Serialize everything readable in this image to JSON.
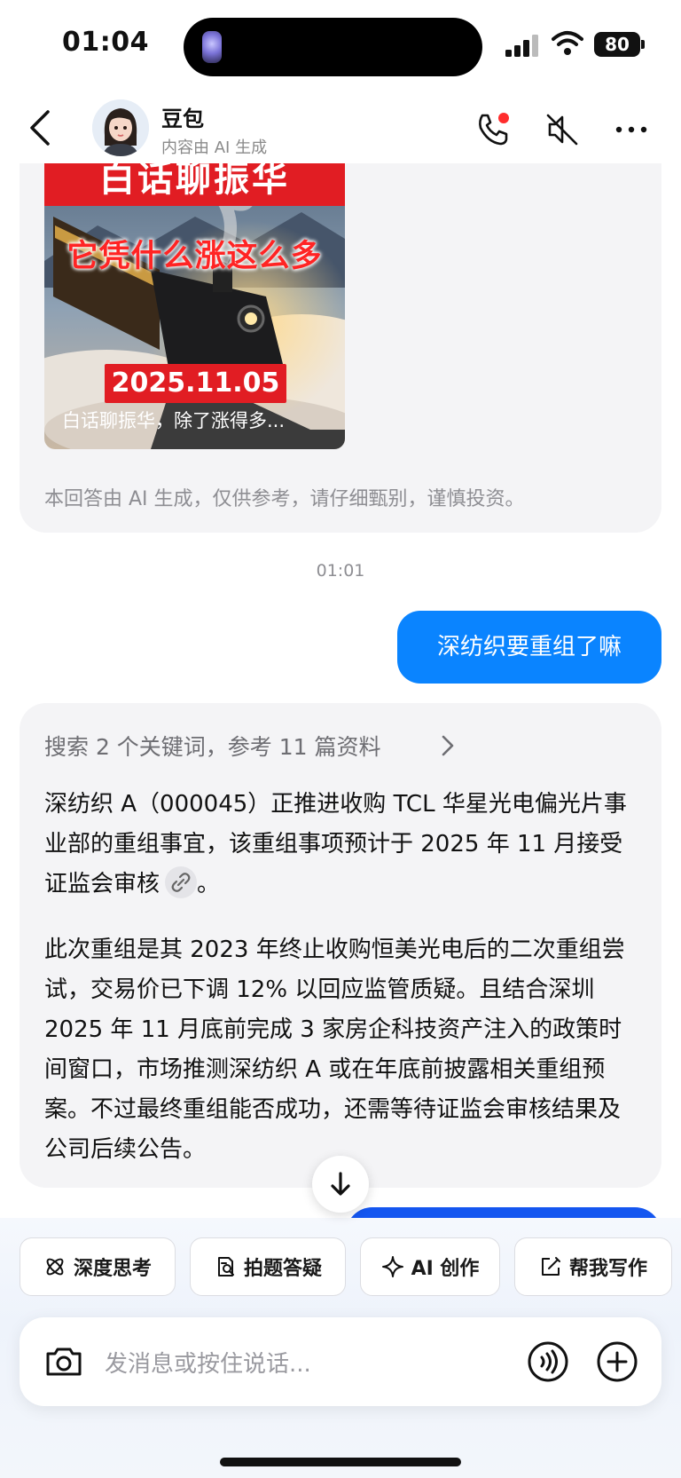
{
  "status_bar": {
    "time": "01:04",
    "battery": "80"
  },
  "header": {
    "name": "豆包",
    "subtitle": "内容由 AI 生成"
  },
  "news_card": {
    "thumb_title": "白话聊振华",
    "thumb_subtitle": "它凭什么涨这么多",
    "thumb_date": "2025.11.05",
    "thumb_caption": "白话聊振华，除了涨得多...",
    "disclaimer": "本回答由 AI 生成，仅供参考，请仔细甄别，谨慎投资。"
  },
  "timestamp": "01:01",
  "user_message": "深纺织要重组了嘛",
  "answer": {
    "search_summary": "搜索 2 个关键词，参考 11 篇资料",
    "para1": "深纺织 A（000045）正推进收购 TCL 华星光电偏光片事业部的重组事宜，该重组事项预计于 2025 年 11 月接受证监会审核",
    "para1_end": "。",
    "para2": "此次重组是其 2023 年终止收购恒美光电后的二次重组尝试，交易价已下调 12% 以回应监管质疑。且结合深圳 2025 年 11 月底前完成 3 家房企科技资产注入的政策时间窗口，市场推测深纺织 A 或在年底前披露相关重组预案。不过最终重组能否成功，还需等待证监会审核结果及公司后续公告。"
  },
  "quick_actions": [
    {
      "label": "深度思考",
      "icon": "atom-icon"
    },
    {
      "label": "拍题答疑",
      "icon": "scan-question-icon"
    },
    {
      "label": "AI 创作",
      "icon": "sparkle-icon"
    },
    {
      "label": "帮我写作",
      "icon": "edit-icon"
    }
  ],
  "input": {
    "placeholder": "发消息或按住说话..."
  }
}
